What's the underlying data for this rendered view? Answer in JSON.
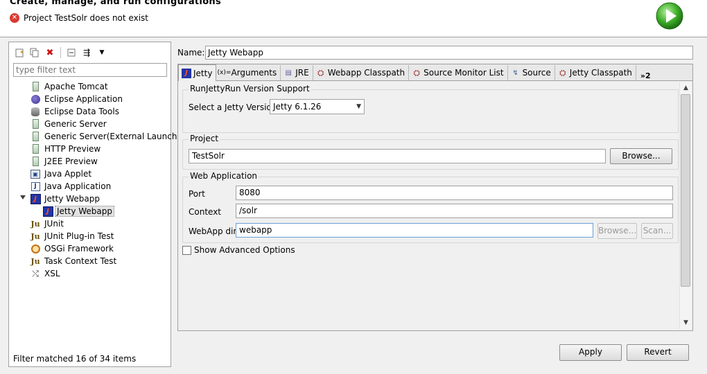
{
  "header": {
    "title": "Create, manage, and run configurations",
    "message": "Project TestSolr does not exist",
    "error_icon": "error-icon",
    "run_icon": "run-icon"
  },
  "left": {
    "toolbar_icons": [
      "new-config-icon",
      "duplicate-icon",
      "delete-icon",
      "collapse-all-icon",
      "filter-icon",
      "dropdown-icon"
    ],
    "filter_placeholder": "type filter text",
    "tree": [
      {
        "label": "Apache Tomcat",
        "icon": "server-icon"
      },
      {
        "label": "Eclipse Application",
        "icon": "eclipse-icon"
      },
      {
        "label": "Eclipse Data Tools",
        "icon": "database-icon"
      },
      {
        "label": "Generic Server",
        "icon": "server-icon"
      },
      {
        "label": "Generic Server(External Launch)",
        "icon": "server-icon"
      },
      {
        "label": "HTTP Preview",
        "icon": "server-icon"
      },
      {
        "label": "J2EE Preview",
        "icon": "server-icon"
      },
      {
        "label": "Java Applet",
        "icon": "applet-icon"
      },
      {
        "label": "Java Application",
        "icon": "java-app-icon"
      },
      {
        "label": "Jetty Webapp",
        "icon": "jetty-icon",
        "expanded": true
      },
      {
        "label": "Jetty Webapp",
        "icon": "jetty-icon",
        "child": true,
        "selected": true
      },
      {
        "label": "JUnit",
        "icon": "junit-icon"
      },
      {
        "label": "JUnit Plug-in Test",
        "icon": "junit-plugin-icon"
      },
      {
        "label": "OSGi Framework",
        "icon": "osgi-icon"
      },
      {
        "label": "Task Context Test",
        "icon": "junit-icon"
      },
      {
        "label": "XSL",
        "icon": "xsl-icon"
      }
    ],
    "status": "Filter matched 16 of 34 items"
  },
  "main": {
    "name_label": "Name:",
    "name_value": "Jetty Webapp",
    "tabs": [
      {
        "label": "Jetty",
        "icon": "jetty-icon"
      },
      {
        "label": "Arguments",
        "icon": "arguments-icon"
      },
      {
        "label": "JRE",
        "icon": "jre-icon"
      },
      {
        "label": "Webapp Classpath",
        "icon": "classpath-icon"
      },
      {
        "label": "Source Monitor List",
        "icon": "classpath-icon"
      },
      {
        "label": "Source",
        "icon": "source-icon"
      },
      {
        "label": "Jetty Classpath",
        "icon": "classpath-icon"
      }
    ],
    "tabs_more": "»2",
    "version_group": {
      "title": "RunJettyRun Version Support",
      "select_label": "Select a Jetty Version:",
      "select_value": "Jetty 6.1.26"
    },
    "project_group": {
      "title": "Project",
      "value": "TestSolr",
      "browse_label": "Browse..."
    },
    "webapp_group": {
      "title": "Web Application",
      "port_label": "Port",
      "port_value": "8080",
      "context_label": "Context",
      "context_value": "/solr",
      "webappdir_label": "WebApp dir",
      "webappdir_value": "webapp",
      "browse_label": "Browse...",
      "scan_label": "Scan..."
    },
    "advanced_label": "Show Advanced Options",
    "apply_label": "Apply",
    "revert_label": "Revert"
  }
}
